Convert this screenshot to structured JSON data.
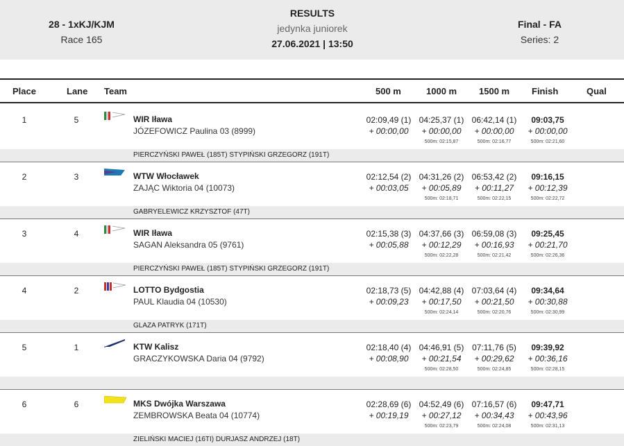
{
  "header": {
    "race_code": "28 - 1xKJ/KJM",
    "race_number": "Race 165",
    "title": "RESULTS",
    "subtitle": "jedynka juniorek",
    "datetime": "27.06.2021 | 13:50",
    "phase": "Final - FA",
    "series": "Series: 2"
  },
  "columns": {
    "place": "Place",
    "lane": "Lane",
    "team": "Team",
    "s500": "500 m",
    "s1000": "1000 m",
    "s1500": "1500 m",
    "finish": "Finish",
    "qual": "Qual"
  },
  "rows": [
    {
      "place": "1",
      "lane": "5",
      "team": "WIR Iława",
      "athlete": "JÓZEFOWICZ  Paulina 03 (8999)",
      "flag": "wir",
      "s500": {
        "time": "02:09,49 (1)",
        "diff": "+ 00:00,00"
      },
      "s1000": {
        "time": "04:25,37 (1)",
        "diff": "+ 00:00,00",
        "pace": "500m: 02:15,87"
      },
      "s1500": {
        "time": "06:42,14 (1)",
        "diff": "+ 00:00,00",
        "pace": "500m: 02:16,77"
      },
      "finish": {
        "time": "09:03,75",
        "diff": "+ 00:00,00",
        "pace": "500m: 02:21,60"
      },
      "coach": "PIERCZYŃSKI PAWEŁ (185T) STYPIŃSKI GRZEGORZ (191T)"
    },
    {
      "place": "2",
      "lane": "3",
      "team": "WTW Włocławek",
      "athlete": "ZAJĄC  Wiktoria 04 (10073)",
      "flag": "wtw",
      "s500": {
        "time": "02:12,54 (2)",
        "diff": "+ 00:03,05"
      },
      "s1000": {
        "time": "04:31,26 (2)",
        "diff": "+ 00:05,89",
        "pace": "500m: 02:18,71"
      },
      "s1500": {
        "time": "06:53,42 (2)",
        "diff": "+ 00:11,27",
        "pace": "500m: 02:22,15"
      },
      "finish": {
        "time": "09:16,15",
        "diff": "+ 00:12,39",
        "pace": "500m: 02:22,72"
      },
      "coach": "GABRYELEWICZ KRZYSZTOF (47T)"
    },
    {
      "place": "3",
      "lane": "4",
      "team": "WIR Iława",
      "athlete": "SAGAN  Aleksandra 05 (9761)",
      "flag": "wir",
      "s500": {
        "time": "02:15,38 (3)",
        "diff": "+ 00:05,88"
      },
      "s1000": {
        "time": "04:37,66 (3)",
        "diff": "+ 00:12,29",
        "pace": "500m: 02:22,28"
      },
      "s1500": {
        "time": "06:59,08 (3)",
        "diff": "+ 00:16,93",
        "pace": "500m: 02:21,42"
      },
      "finish": {
        "time": "09:25,45",
        "diff": "+ 00:21,70",
        "pace": "500m: 02:26,36"
      },
      "coach": "PIERCZYŃSKI PAWEŁ (185T) STYPIŃSKI GRZEGORZ (191T)"
    },
    {
      "place": "4",
      "lane": "2",
      "team": "LOTTO Bydgostia",
      "athlete": "PAUL  Klaudia 04 (10530)",
      "flag": "lotto",
      "s500": {
        "time": "02:18,73 (5)",
        "diff": "+ 00:09,23"
      },
      "s1000": {
        "time": "04:42,88 (4)",
        "diff": "+ 00:17,50",
        "pace": "500m: 02:24,14"
      },
      "s1500": {
        "time": "07:03,64 (4)",
        "diff": "+ 00:21,50",
        "pace": "500m: 02:20,76"
      },
      "finish": {
        "time": "09:34,64",
        "diff": "+ 00:30,88",
        "pace": "500m: 02:30,99"
      },
      "coach": "GLAZA PATRYK (171T)"
    },
    {
      "place": "5",
      "lane": "1",
      "team": "KTW Kalisz",
      "athlete": "GRACZYKOWSKA  Daria 04 (9792)",
      "flag": "ktw",
      "s500": {
        "time": "02:18,40 (4)",
        "diff": "+ 00:08,90"
      },
      "s1000": {
        "time": "04:46,91 (5)",
        "diff": "+ 00:21,54",
        "pace": "500m: 02:28,50"
      },
      "s1500": {
        "time": "07:11,76 (5)",
        "diff": "+ 00:29,62",
        "pace": "500m: 02:24,85"
      },
      "finish": {
        "time": "09:39,92",
        "diff": "+ 00:36,16",
        "pace": "500m: 02:28,15"
      },
      "coach": ""
    },
    {
      "place": "6",
      "lane": "6",
      "team": "MKS Dwójka Warszawa",
      "athlete": "ZEMBROWSKA  Beata 04 (10774)",
      "flag": "mks",
      "s500": {
        "time": "02:28,69 (6)",
        "diff": "+ 00:19,19"
      },
      "s1000": {
        "time": "04:52,49 (6)",
        "diff": "+ 00:27,12",
        "pace": "500m: 02:23,79"
      },
      "s1500": {
        "time": "07:16,57 (6)",
        "diff": "+ 00:34,43",
        "pace": "500m: 02:24,08"
      },
      "finish": {
        "time": "09:47,71",
        "diff": "+ 00:43,96",
        "pace": "500m: 02:31,13"
      },
      "coach": "ZIELIŃSKI MACIEJ (16TI) DURJASZ ANDRZEJ (18T)"
    }
  ]
}
